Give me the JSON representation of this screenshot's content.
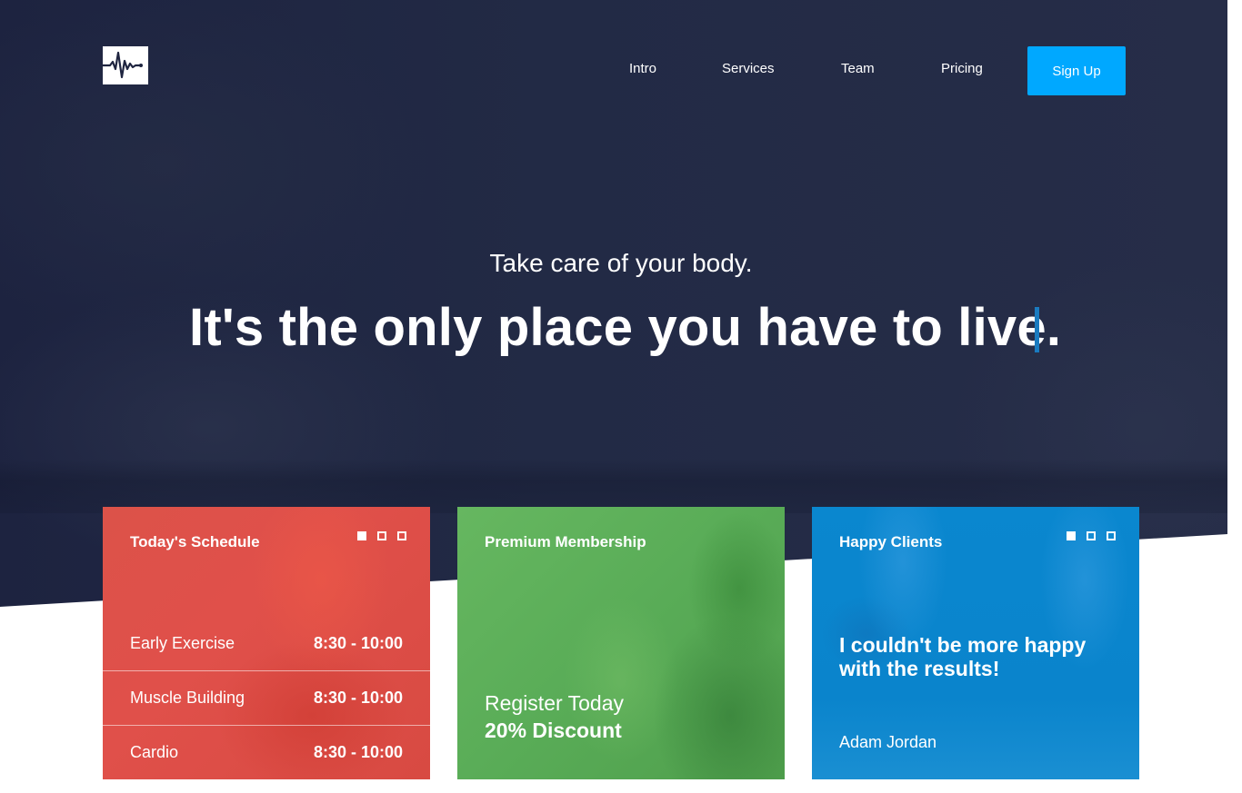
{
  "logo": {
    "icon": "heartbeat-icon"
  },
  "nav": {
    "links": [
      "Intro",
      "Services",
      "Team",
      "Pricing"
    ],
    "signup_label": "Sign Up",
    "signup_color": "#00a8ff"
  },
  "hero": {
    "tagline": "Take care of your body.",
    "headline": "It's the only place you have to live.",
    "background_color": "#222a45",
    "cursor_color": "#1a7bc0"
  },
  "cards": {
    "schedule": {
      "title": "Today's Schedule",
      "color": "#dc5249",
      "slider_dots": 3,
      "active_dot": 0,
      "rows": [
        {
          "name": "Early Exercise",
          "time": "8:30 - 10:00"
        },
        {
          "name": "Muscle Building",
          "time": "8:30 - 10:00"
        },
        {
          "name": "Cardio",
          "time": "8:30 - 10:00"
        }
      ]
    },
    "membership": {
      "title": "Premium Membership",
      "color": "#5cae57",
      "line1": "Register Today",
      "line2": "20% Discount"
    },
    "clients": {
      "title": "Happy Clients",
      "color": "#0a87cf",
      "slider_dots": 3,
      "active_dot": 0,
      "quote": "I couldn't be more happy with the results!",
      "author": "Adam Jordan"
    }
  }
}
